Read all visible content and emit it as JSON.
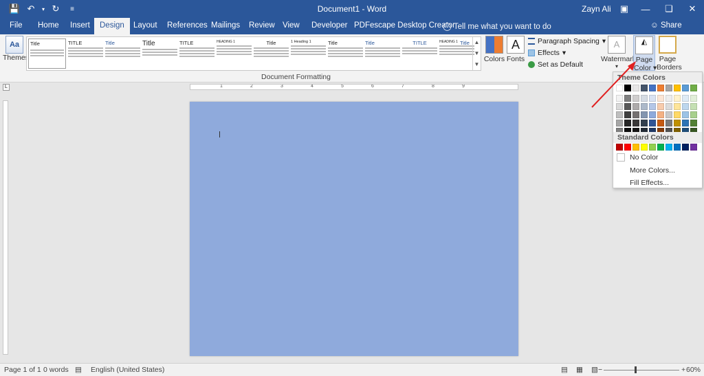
{
  "app": {
    "doc_title": "Document1 - Word",
    "user": "Zayn Ali"
  },
  "tabs": [
    {
      "label": "File"
    },
    {
      "label": "Home"
    },
    {
      "label": "Insert"
    },
    {
      "label": "Design"
    },
    {
      "label": "Layout"
    },
    {
      "label": "References"
    },
    {
      "label": "Mailings"
    },
    {
      "label": "Review"
    },
    {
      "label": "View"
    },
    {
      "label": "Developer"
    },
    {
      "label": "PDFescape Desktop Creator"
    }
  ],
  "active_tab": "Design",
  "tell_me": "Tell me what you want to do",
  "share": "Share",
  "ribbon": {
    "themes": "Themes",
    "style_set_titles": [
      "Title",
      "TITLE",
      "Title",
      "Title",
      "TITLE",
      "HEADING 1",
      "Title",
      "1 Heading 1",
      "Title",
      "Title",
      "TITLE",
      "HEADING 1",
      "Title"
    ],
    "document_formatting": "Document Formatting",
    "colors": "Colors",
    "fonts": "Fonts",
    "paragraph_spacing": "Paragraph Spacing",
    "effects": "Effects",
    "set_as_default": "Set as Default",
    "watermark": "Watermark",
    "page_color_line1": "Page",
    "page_color_line2": "Color",
    "page_borders_line1": "Page",
    "page_borders_line2": "Borders"
  },
  "ruler": {
    "numbers": [
      "1",
      "2",
      "3",
      "4",
      "5",
      "6",
      "7",
      "8",
      "9"
    ]
  },
  "dropdown": {
    "theme_colors_header": "Theme Colors",
    "standard_colors_header": "Standard Colors",
    "no_color": "No Color",
    "more_colors": "More Colors...",
    "fill_effects": "Fill Effects...",
    "theme_columns": [
      [
        "#ffffff",
        "#f2f2f2",
        "#d9d9d9",
        "#bfbfbf",
        "#a6a6a6",
        "#808080"
      ],
      [
        "#000000",
        "#7f7f7f",
        "#595959",
        "#3f3f3f",
        "#262626",
        "#0d0d0d"
      ],
      [
        "#e7e6e6",
        "#d0cece",
        "#aeabab",
        "#757171",
        "#3a3838",
        "#171616"
      ],
      [
        "#44546a",
        "#d6dce4",
        "#adb9ca",
        "#8496b0",
        "#323f4f",
        "#222a35"
      ],
      [
        "#4472c4",
        "#d9e2f3",
        "#b4c6e7",
        "#8eaadb",
        "#2f5496",
        "#1f3864"
      ],
      [
        "#ed7d31",
        "#fbe5d5",
        "#f7cbac",
        "#f4b183",
        "#c55a11",
        "#833c0b"
      ],
      [
        "#a5a5a5",
        "#ededed",
        "#dbdbdb",
        "#c9c9c9",
        "#7b7b7b",
        "#525252"
      ],
      [
        "#ffc000",
        "#fff2cc",
        "#fee599",
        "#ffd966",
        "#bf9000",
        "#7f6000"
      ],
      [
        "#5b9bd5",
        "#deebf6",
        "#bdd7ee",
        "#9cc3e5",
        "#2e75b5",
        "#1f4e79"
      ],
      [
        "#70ad47",
        "#e2efd9",
        "#c5e0b3",
        "#a8d08d",
        "#538135",
        "#375623"
      ]
    ],
    "standard_colors": [
      "#c00000",
      "#ff0000",
      "#ffc000",
      "#ffff00",
      "#92d050",
      "#00b050",
      "#00b0f0",
      "#0070c0",
      "#002060",
      "#7030a0"
    ]
  },
  "page": {
    "background_color": "#8faadc"
  },
  "status": {
    "page": "Page 1 of 1",
    "words": "0 words",
    "language": "English (United States)",
    "zoom": "60%"
  }
}
